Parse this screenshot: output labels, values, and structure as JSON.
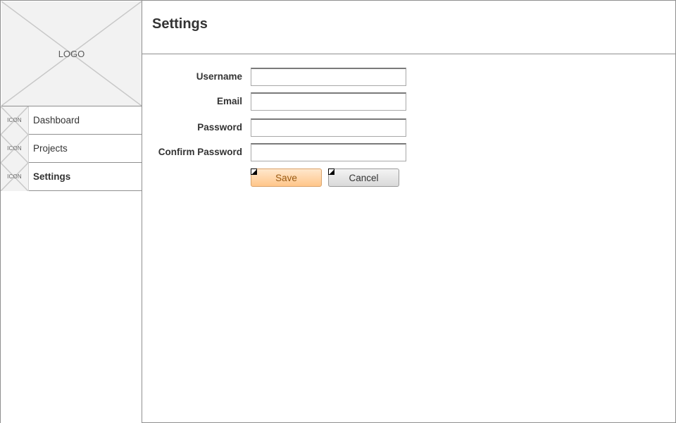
{
  "sidebar": {
    "logo_text": "LOGO",
    "items": [
      {
        "icon_text": "ICON",
        "label": "Dashboard",
        "active": false
      },
      {
        "icon_text": "ICON",
        "label": "Projects",
        "active": false
      },
      {
        "icon_text": "ICON",
        "label": "Settings",
        "active": true
      }
    ]
  },
  "header": {
    "title": "Settings"
  },
  "form": {
    "fields": [
      {
        "label": "Username",
        "value": "",
        "placeholder": ""
      },
      {
        "label": "Email",
        "value": "",
        "placeholder": ""
      },
      {
        "label": "Password",
        "value": "",
        "placeholder": ""
      },
      {
        "label": "Confirm Password",
        "value": "",
        "placeholder": ""
      }
    ],
    "save_label": "Save",
    "cancel_label": "Cancel"
  },
  "colors": {
    "save_button": "#ffc68a",
    "cancel_button": "#d9d9d9",
    "placeholder_fill": "#f2f2f2",
    "border": "#8f8f8f"
  },
  "icons": {
    "logo": "image-placeholder-icon",
    "nav": "image-placeholder-icon"
  }
}
